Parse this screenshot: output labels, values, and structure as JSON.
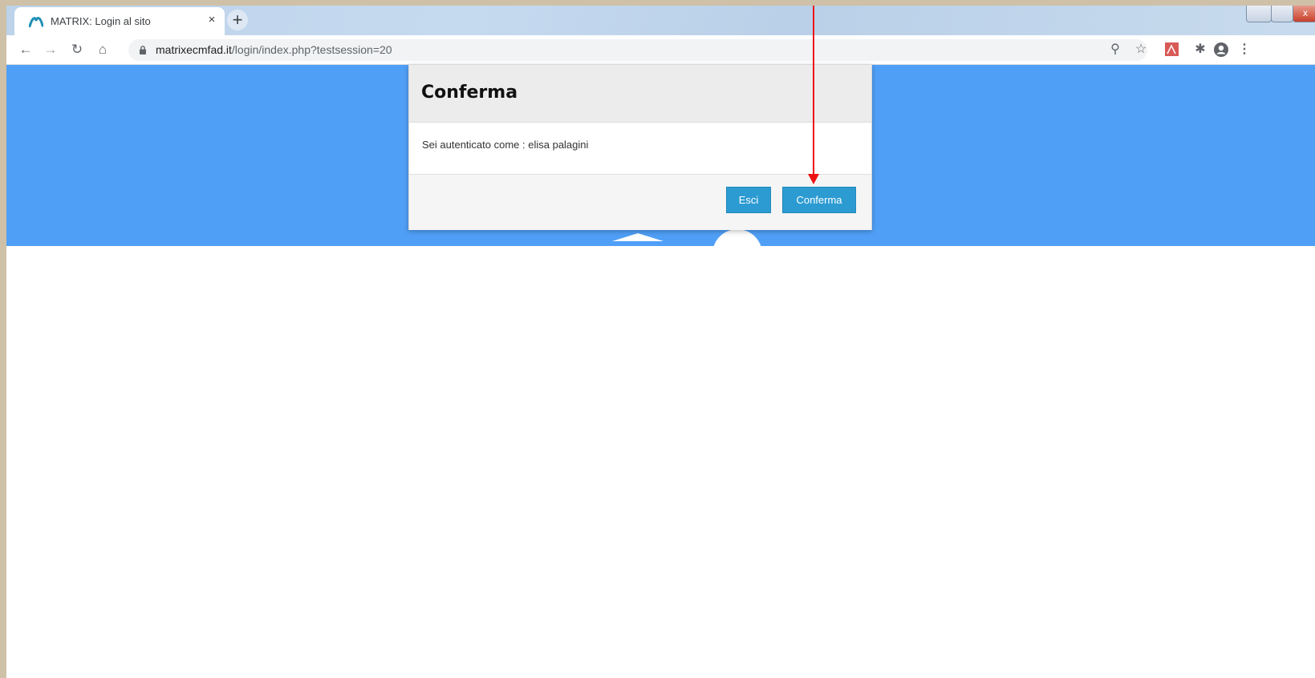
{
  "browser": {
    "tab_title": "MATRIX: Login al sito",
    "tab_close": "×",
    "new_tab": "+",
    "window_close": "x",
    "url_host": "matrixecmfad.it",
    "url_path": "/login/index.php?testsession=20",
    "nav_icons": [
      "back-icon",
      "forward-icon",
      "reload-icon",
      "home-icon"
    ],
    "toolbar_icons": [
      "key-icon",
      "star-icon",
      "pdf-extension-icon",
      "extensions-icon",
      "profile-icon",
      "menu-icon"
    ]
  },
  "dialog": {
    "title": "Conferma",
    "message": "Sei autenticato come : elisa palagini",
    "cancel_label": "Esci",
    "confirm_label": "Conferma"
  },
  "colors": {
    "hero_background": "#509ff7",
    "button": "#2c9bd2",
    "annotation_arrow": "#ee1111"
  }
}
